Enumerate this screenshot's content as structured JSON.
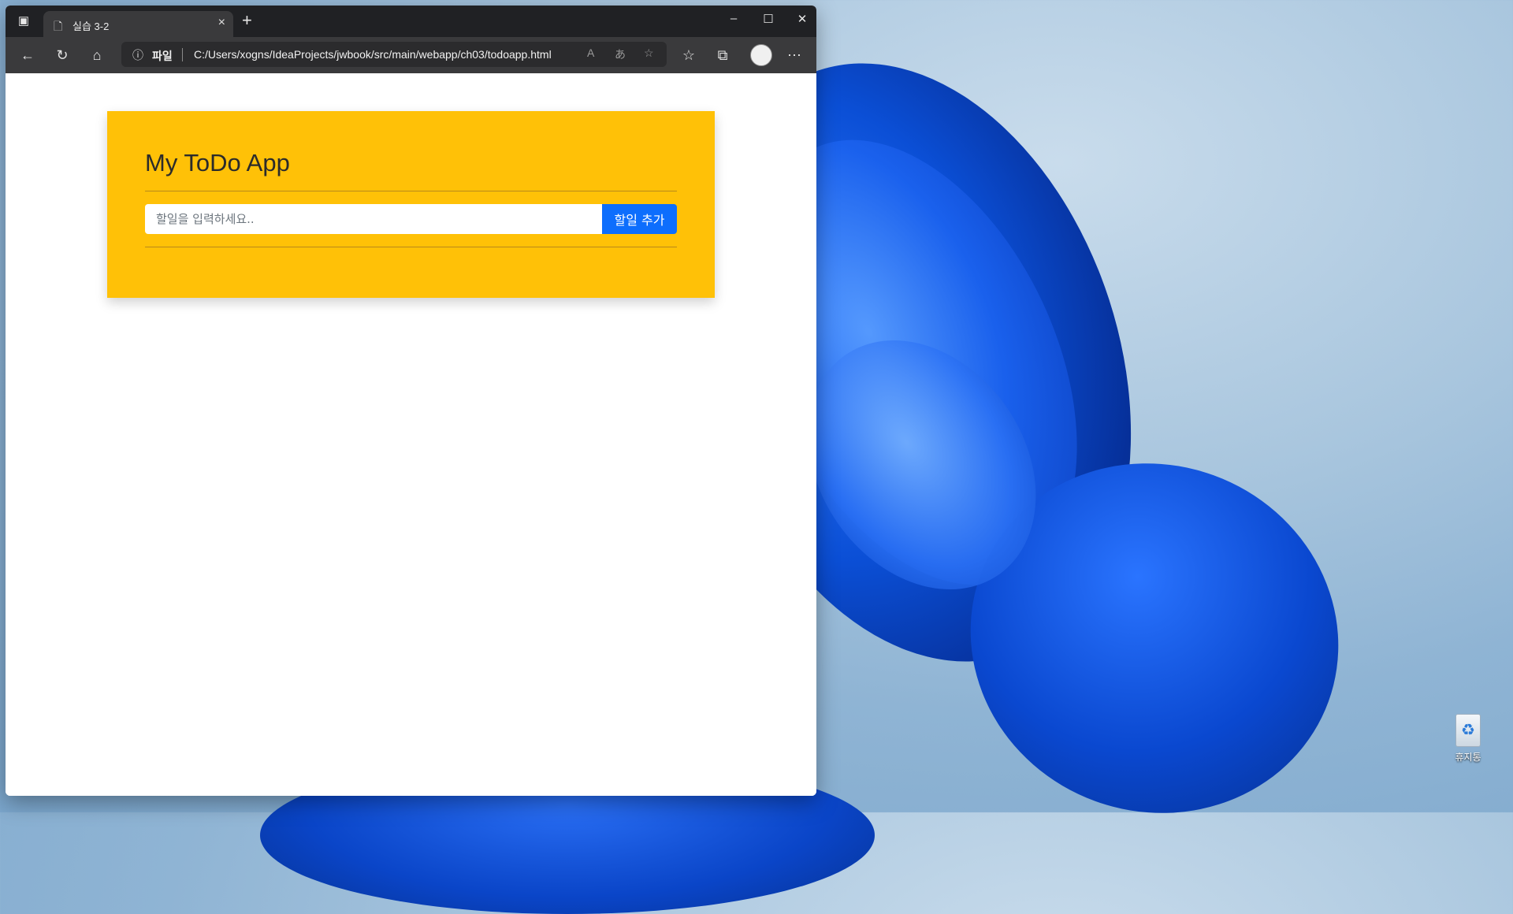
{
  "browser": {
    "tab": {
      "title": "실습 3-2"
    },
    "address": {
      "scheme_label": "파일",
      "url": "C:/Users/xogns/IdeaProjects/jwbook/src/main/webapp/ch03/todoapp.html"
    }
  },
  "app": {
    "title": "My ToDo App",
    "input": {
      "placeholder": "할일을 입력하세요..",
      "value": ""
    },
    "add_button_label": "할일 추가",
    "accent_color": "#ffc107",
    "button_color": "#0d6efd"
  },
  "desktop": {
    "recycle_bin_label": "휴지통"
  }
}
